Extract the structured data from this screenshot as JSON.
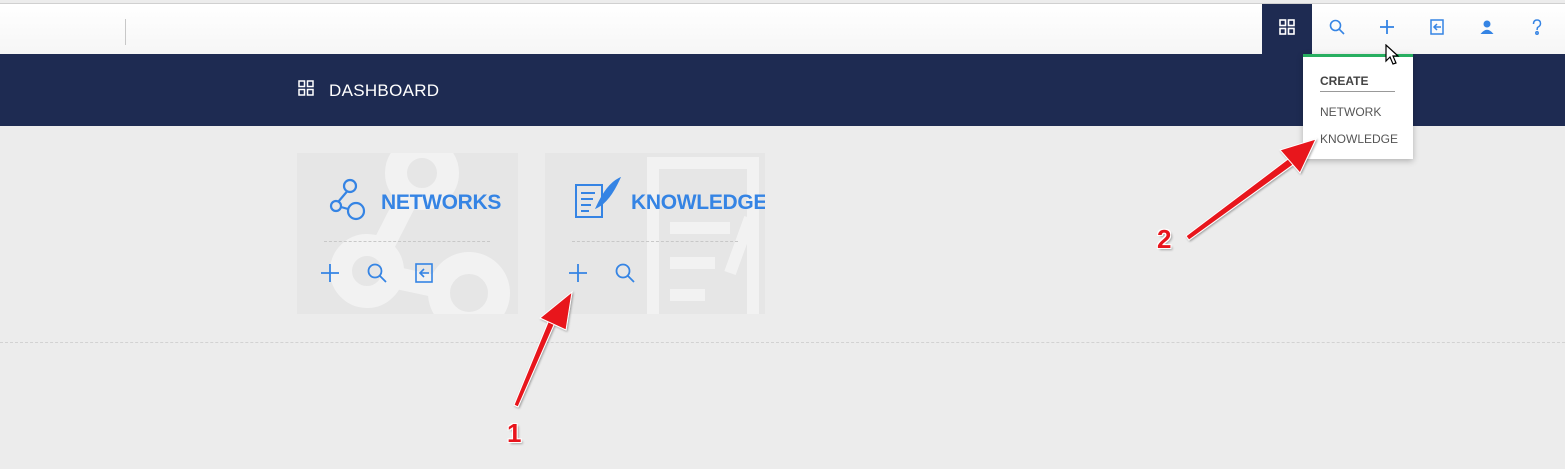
{
  "topbar": {
    "icons": [
      {
        "name": "dashboard-icon",
        "active": true
      },
      {
        "name": "search-icon",
        "active": false
      },
      {
        "name": "add-icon",
        "active": false
      },
      {
        "name": "import-icon",
        "active": false
      },
      {
        "name": "user-icon",
        "active": false
      },
      {
        "name": "help-icon",
        "active": false
      }
    ]
  },
  "header": {
    "title": "DASHBOARD"
  },
  "cards": {
    "networks": {
      "title": "NETWORKS",
      "icon": "network-icon",
      "actions": [
        "add-icon",
        "search-icon",
        "import-icon"
      ]
    },
    "knowledge": {
      "title": "KNOWLEDGE",
      "icon": "knowledge-icon",
      "actions": [
        "add-icon",
        "search-icon"
      ]
    }
  },
  "create_menu": {
    "header": "CREATE",
    "items": [
      "NETWORK",
      "KNOWLEDGE"
    ]
  },
  "annotations": {
    "one": "1",
    "two": "2"
  },
  "colors": {
    "navy": "#1e2b52",
    "accent_blue": "#3584e4",
    "menu_green": "#27ae60",
    "annotation_red": "#e8141c",
    "background": "#ececec"
  }
}
